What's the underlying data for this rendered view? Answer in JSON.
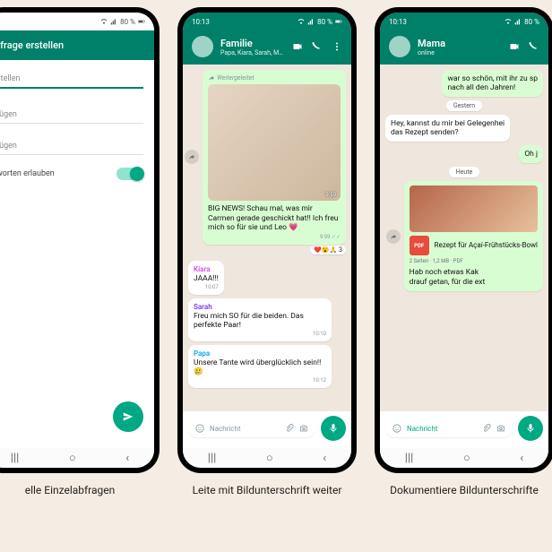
{
  "status": {
    "time": "10:13",
    "battery": "80 %"
  },
  "phone1": {
    "header": "nfrage erstellen",
    "question_ph": "stellen",
    "option1_ph": "fügen",
    "option2_ph": "fügen",
    "allow_multi": "worten erlauben",
    "caption": "elle Einzelabfragen"
  },
  "phone2": {
    "chat_name": "Familie",
    "chat_sub": "Papa, Kiara, Sarah, Mama...",
    "forwarded": "Weitergeleitet",
    "img_time": "9:59",
    "big_text": "BIG NEWS! Schau mal, was mir Carmen gerade geschickt hat!! Ich freu mich so für sie und Leo 💗",
    "big_time": "9:59",
    "reactions": "❤️😮🙏 3",
    "m1": {
      "sender": "Kiara",
      "color": "#d946ef",
      "text": "JAAA!!!",
      "time": "10:07"
    },
    "m2": {
      "sender": "Sarah",
      "color": "#7c3aed",
      "text": "Freu mich SO für die beiden. Das perfekte Paar!",
      "time": "10:10"
    },
    "m3": {
      "sender": "Papa",
      "color": "#0ea5e9",
      "text": "Unsere Tante wird überglücklich sein!! 🥲",
      "time": "10:12"
    },
    "input_ph": "Nachricht",
    "caption": "Leite mit Bildunterschrift weiter"
  },
  "phone3": {
    "chat_name": "Mama",
    "chat_sub": "online",
    "prev_out": "war so schön, mit ihr zu sp\nnach all den Jahren!",
    "day_yesterday": "Gestern",
    "prev_in": "Hey, kannst du mir bei Gelegenhei\ndas Rezept senden?",
    "reply_out": "Oh j",
    "day_today": "Heute",
    "doc_title": "Rezept für Açaí-Frühstücks-Bowl",
    "doc_meta": "2 Seiten · 1,2 MB · PDF",
    "doc_caption": "Hab noch etwas Kak\ndrauf getan, für die ext",
    "input_ph": "Nachricht",
    "caption": "Dokumentiere Bildunterschrifte"
  }
}
